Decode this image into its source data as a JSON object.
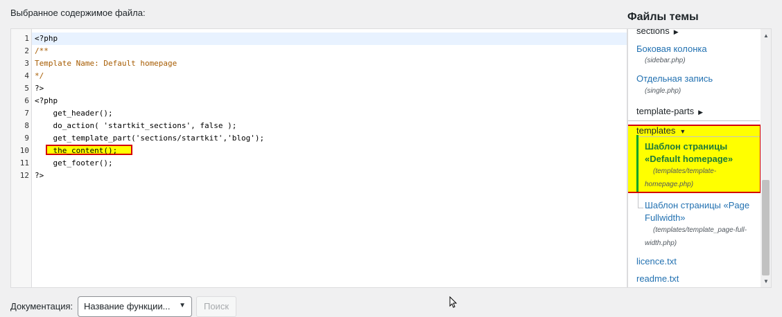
{
  "editor": {
    "title": "Выбранное содержимое файла:",
    "line_numbers": [
      "1",
      "2",
      "3",
      "4",
      "5",
      "6",
      "7",
      "8",
      "9",
      "10",
      "11",
      "12"
    ],
    "lines": [
      {
        "text": "<?php",
        "cls": ""
      },
      {
        "text": "/**",
        "cls": "c-comment"
      },
      {
        "text": "Template Name: Default homepage",
        "cls": "c-comment"
      },
      {
        "text": "*/",
        "cls": "c-comment"
      },
      {
        "text": "?>",
        "cls": ""
      },
      {
        "text": "<?php",
        "cls": ""
      },
      {
        "text": "    get_header();",
        "cls": ""
      },
      {
        "text": "    do_action( 'startkit_sections', false );",
        "cls": ""
      },
      {
        "text": "    get_template_part('sections/startkit','blog');",
        "cls": ""
      },
      {
        "text": "    the_content();",
        "cls": ""
      },
      {
        "text": "    get_footer();",
        "cls": ""
      },
      {
        "text": "?>",
        "cls": ""
      }
    ]
  },
  "sidebar": {
    "title": "Файлы темы",
    "sections_label": "sections",
    "sidebar_label": "Боковая колонка",
    "sidebar_file": "(sidebar.php)",
    "single_label": "Отдельная запись",
    "single_file": "(single.php)",
    "template_parts_label": "template-parts",
    "templates_label": "templates",
    "active_label_1": "Шаблон страницы",
    "active_label_2": "«Default homepage»",
    "active_file_1": "(templates/template-",
    "active_file_2": "homepage.php)",
    "fullwidth_label_1": "Шаблон страницы «Page",
    "fullwidth_label_2": "Fullwidth»",
    "fullwidth_file_1": "(templates/template_page-full-",
    "fullwidth_file_2": "width.php)",
    "licence": "licence.txt",
    "readme": "readme.txt"
  },
  "doc": {
    "label": "Документация:",
    "select_value": "Название функции...",
    "search_button": "Поиск"
  },
  "colors": {
    "highlight": "#ffff00",
    "highlight_border": "#d40000",
    "active_bar": "#00a32a",
    "link": "#2271b1"
  }
}
